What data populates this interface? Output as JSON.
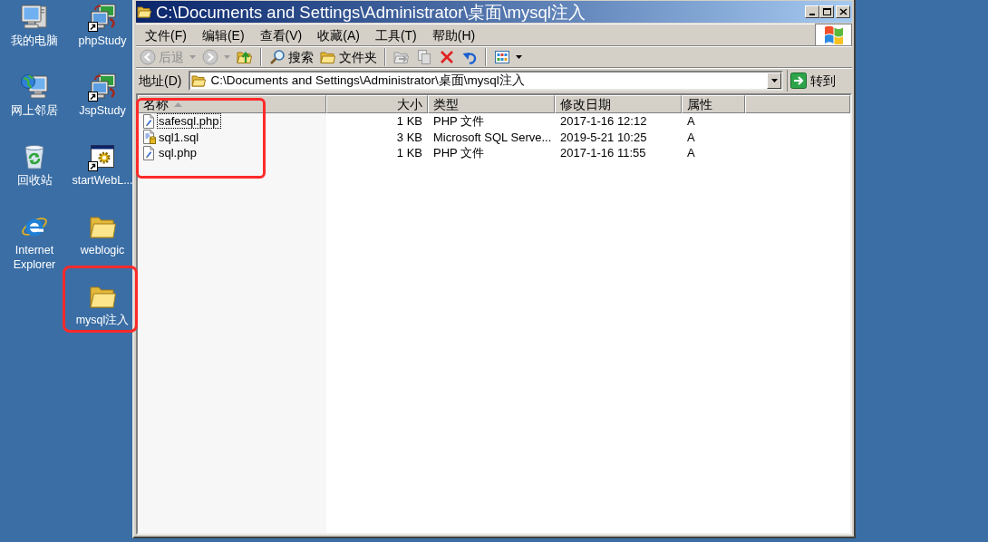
{
  "desktop": {
    "columns": [
      {
        "icons": [
          {
            "label": "我的电脑",
            "kind": "computer",
            "shortcut": false,
            "highlighted": false
          },
          {
            "label": "网上邻居",
            "kind": "network",
            "shortcut": false,
            "highlighted": false
          },
          {
            "label": "回收站",
            "kind": "recycle-bin",
            "shortcut": false,
            "highlighted": false
          },
          {
            "label": "Internet Explorer",
            "kind": "browser",
            "shortcut": false,
            "highlighted": false
          }
        ]
      },
      {
        "icons": [
          {
            "label": "phpStudy",
            "kind": "app",
            "shortcut": true,
            "highlighted": false
          },
          {
            "label": "JspStudy",
            "kind": "app",
            "shortcut": true,
            "highlighted": false
          },
          {
            "label": "startWebL...",
            "kind": "program",
            "shortcut": true,
            "highlighted": false
          },
          {
            "label": "weblogic",
            "kind": "folder",
            "shortcut": false,
            "highlighted": false
          },
          {
            "label": "mysql注入",
            "kind": "folder",
            "shortcut": false,
            "highlighted": true
          }
        ]
      }
    ]
  },
  "window": {
    "title": "C:\\Documents and Settings\\Administrator\\桌面\\mysql注入",
    "menu": [
      "文件(F)",
      "编辑(E)",
      "查看(V)",
      "收藏(A)",
      "工具(T)",
      "帮助(H)"
    ],
    "toolbar": [
      {
        "kind": "back",
        "label": "后退",
        "disabled": true,
        "dropdown": true
      },
      {
        "kind": "forward",
        "disabled": true,
        "dropdown": true
      },
      {
        "kind": "up",
        "disabled": false,
        "dropdown": false
      },
      {
        "kind": "separator"
      },
      {
        "kind": "search",
        "label": "搜索",
        "disabled": false,
        "dropdown": false
      },
      {
        "kind": "folders",
        "label": "文件夹",
        "disabled": false,
        "dropdown": false
      },
      {
        "kind": "separator"
      },
      {
        "kind": "move",
        "disabled": true,
        "dropdown": false
      },
      {
        "kind": "copy",
        "disabled": true,
        "dropdown": false
      },
      {
        "kind": "delete",
        "disabled": false,
        "dropdown": false
      },
      {
        "kind": "undo",
        "disabled": false,
        "dropdown": false
      },
      {
        "kind": "separator"
      },
      {
        "kind": "views",
        "disabled": false,
        "dropdown": true
      }
    ],
    "address": {
      "label": "地址(D)",
      "value": "C:\\Documents and Settings\\Administrator\\桌面\\mysql注入",
      "go_label": "转到"
    },
    "file_list": {
      "columns": [
        {
          "label": "名称",
          "sorted": true,
          "highlighted": true
        },
        {
          "label": "大小",
          "sorted": false,
          "highlighted": false
        },
        {
          "label": "类型",
          "sorted": false,
          "highlighted": false
        },
        {
          "label": "修改日期",
          "sorted": false,
          "highlighted": false
        },
        {
          "label": "属性",
          "sorted": false,
          "highlighted": false
        }
      ],
      "rows": [
        {
          "kind": "php",
          "focused": true,
          "cells": [
            "safesql.php",
            "1 KB",
            "PHP 文件",
            "2017-1-16 12:12",
            "A"
          ]
        },
        {
          "kind": "sql",
          "focused": false,
          "cells": [
            "sql1.sql",
            "3 KB",
            "Microsoft SQL Serve...",
            "2019-5-21 10:25",
            "A"
          ]
        },
        {
          "kind": "php",
          "focused": false,
          "cells": [
            "sql.php",
            "1 KB",
            "PHP 文件",
            "2017-1-16 11:55",
            "A"
          ]
        }
      ]
    }
  }
}
